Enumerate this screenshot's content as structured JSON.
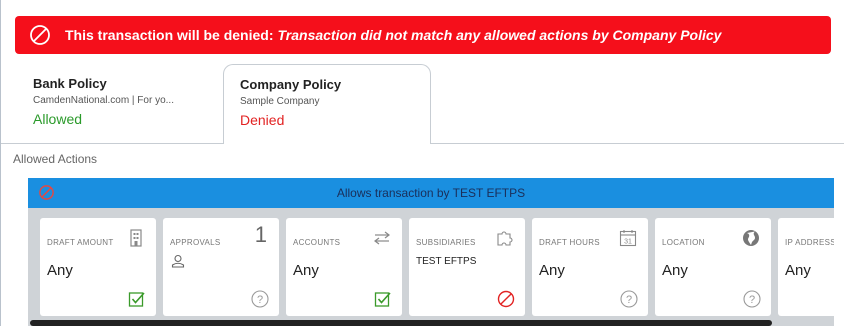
{
  "banner": {
    "prefix": "This transaction will be denied:",
    "reason": "Transaction did not match any allowed actions by Company Policy",
    "color": "#f50f1b"
  },
  "tabs": [
    {
      "title": "Bank Policy",
      "subtitle": "CamdenNational.com | For yo...",
      "status": "Allowed",
      "active": false
    },
    {
      "title": "Company Policy",
      "subtitle": "Sample Company",
      "status": "Denied",
      "active": true
    }
  ],
  "section_label": "Allowed Actions",
  "rule": {
    "header": "Allows transaction by TEST EFTPS",
    "header_color": "#1a8fe0",
    "cards": [
      {
        "label": "DRAFT AMOUNT",
        "value": "Any",
        "icon": "building-icon",
        "status": "check-icon"
      },
      {
        "label": "APPROVALS",
        "count": "1",
        "icon": "user-icon",
        "status": "help-icon"
      },
      {
        "label": "ACCOUNTS",
        "value": "Any",
        "icon": "transfer-arrows-icon",
        "status": "check-icon"
      },
      {
        "label": "SUBSIDIARIES",
        "value": "TEST EFTPS",
        "icon": "puzzle-icon",
        "status": "ban-icon"
      },
      {
        "label": "DRAFT HOURS",
        "value": "Any",
        "icon": "calendar-icon",
        "status": "help-icon"
      },
      {
        "label": "LOCATION",
        "value": "Any",
        "icon": "globe-icon",
        "status": "help-icon"
      },
      {
        "label": "IP ADDRESS",
        "value": "Any"
      }
    ]
  },
  "calendar_day": "31"
}
